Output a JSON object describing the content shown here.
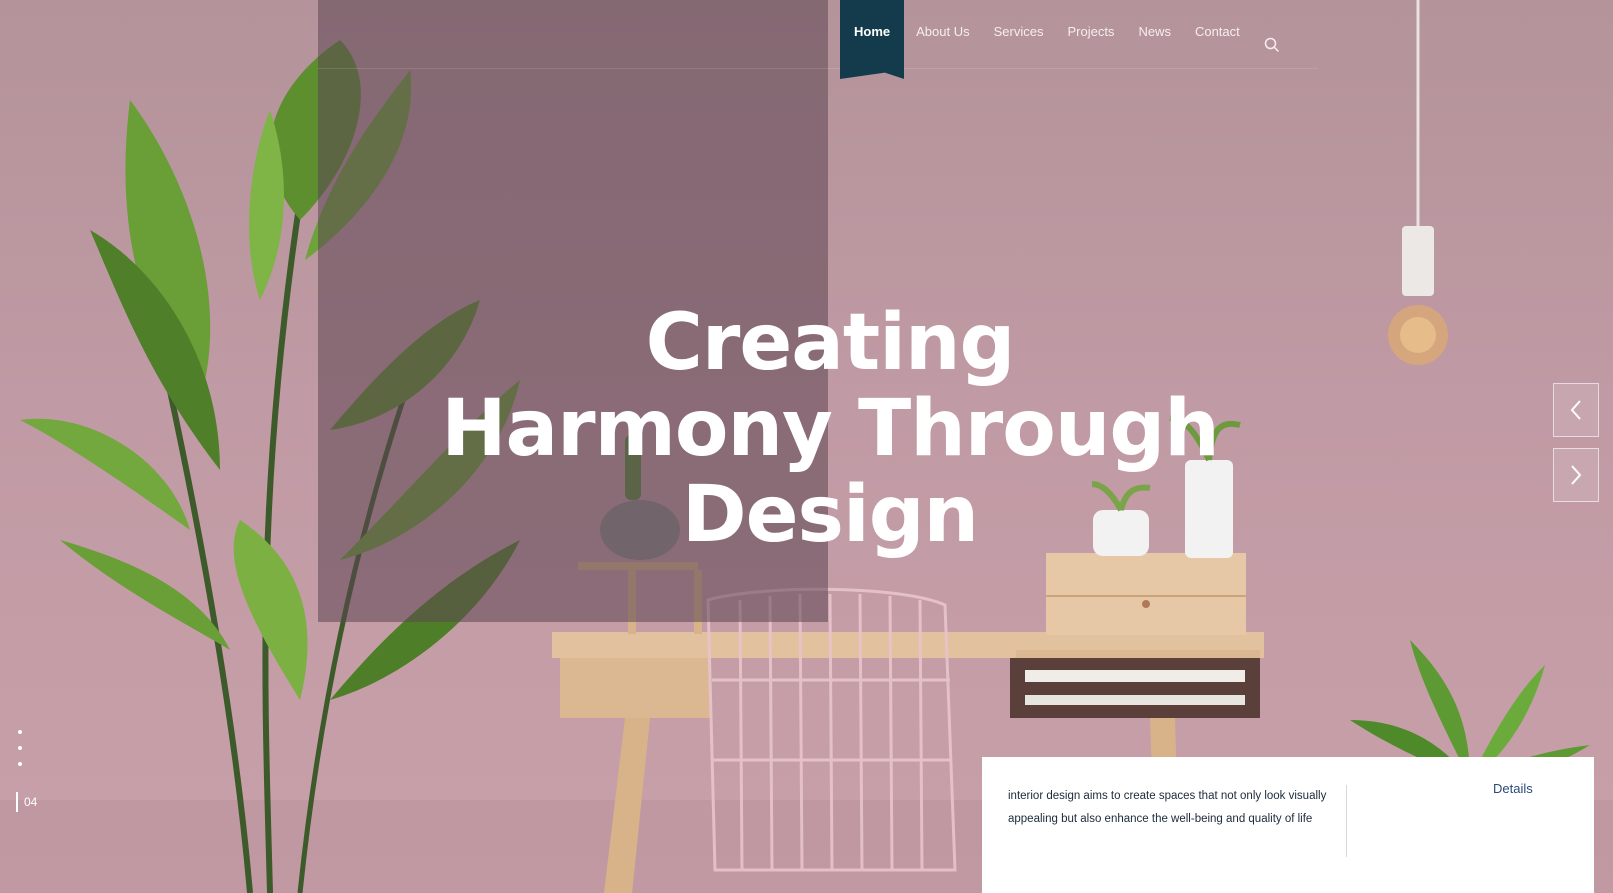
{
  "nav": {
    "items": [
      {
        "label": "Home",
        "active": true
      },
      {
        "label": "About Us"
      },
      {
        "label": "Services"
      },
      {
        "label": "Projects"
      },
      {
        "label": "News"
      },
      {
        "label": "Contact"
      }
    ],
    "search_icon": "search-icon"
  },
  "hero": {
    "line1": "Creating",
    "line2": "Harmony Through",
    "line3": "Design"
  },
  "slider": {
    "counter": "04",
    "prev_icon": "chevron-left-icon",
    "next_icon": "chevron-right-icon"
  },
  "info": {
    "text": "interior design aims to create spaces that not only look visually appealing but also enhance the well-being and quality of life",
    "link": "Details"
  },
  "colors": {
    "wall": "#c29ca6",
    "nav_active": "#143b4b",
    "hero_text": "#ffffff",
    "card_bg": "#ffffff",
    "link": "#2a4a7a"
  }
}
